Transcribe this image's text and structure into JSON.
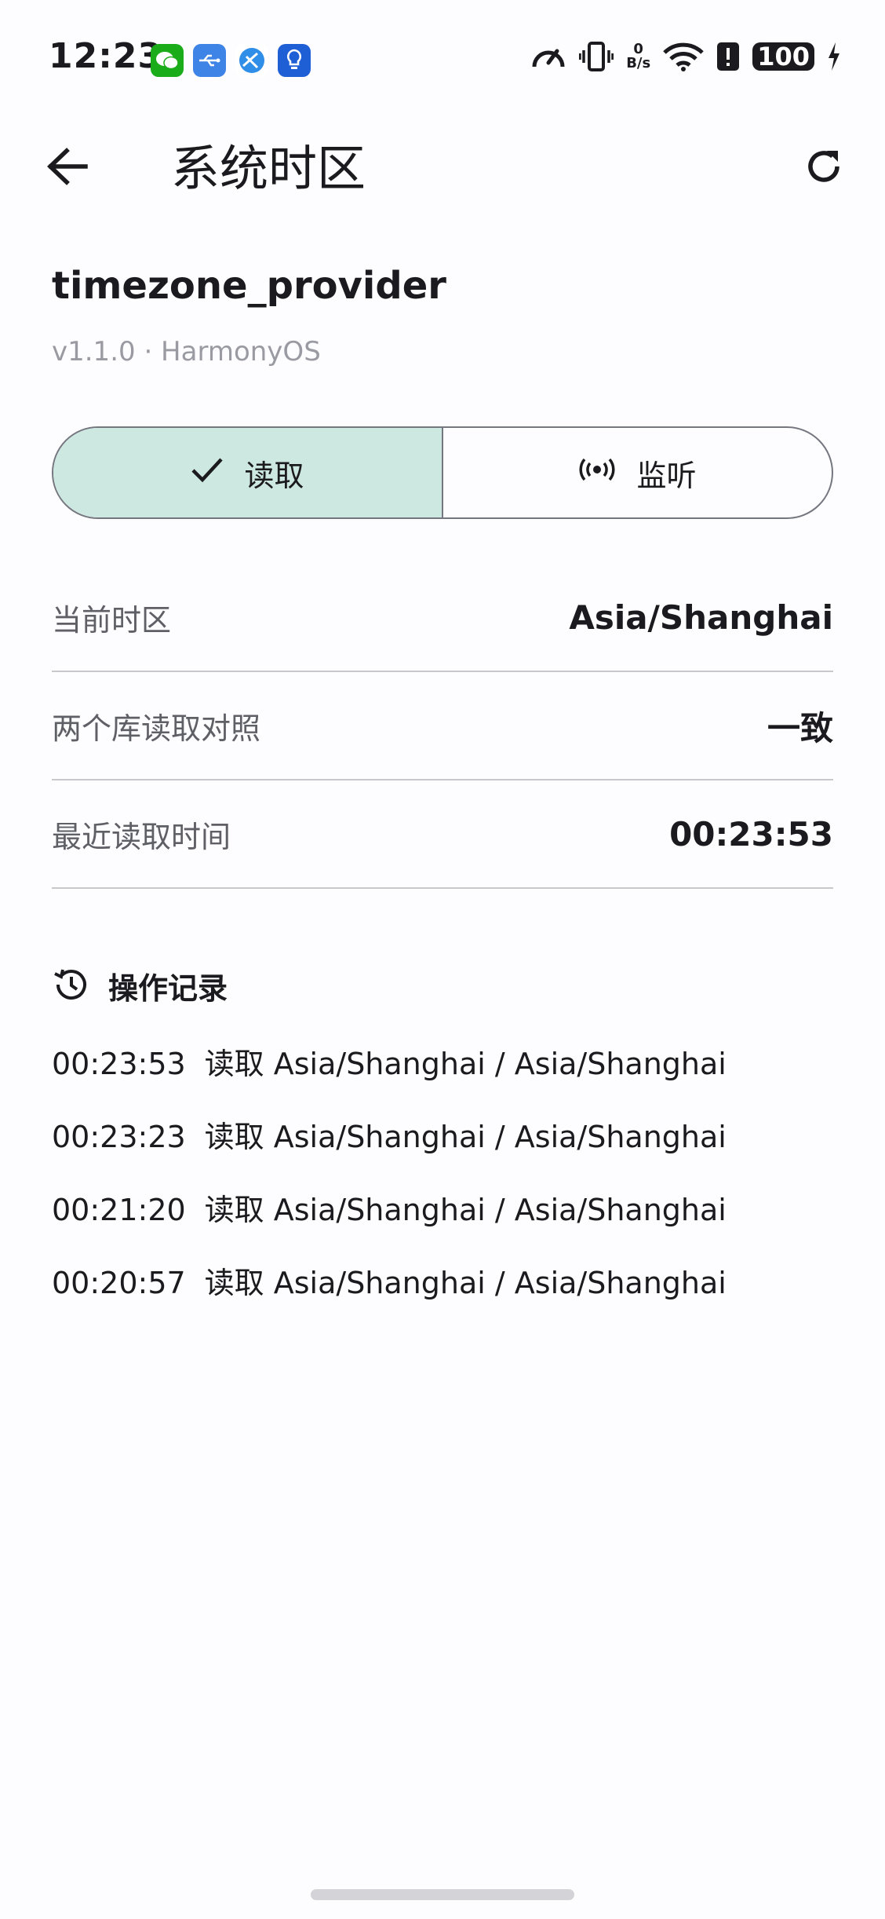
{
  "status_bar": {
    "time": "12:23",
    "net_speed_value": "0",
    "net_speed_unit": "B/s",
    "battery": "100"
  },
  "app_bar": {
    "title": "系统时区"
  },
  "provider": {
    "name": "timezone_provider",
    "meta": "v1.1.0 · HarmonyOS"
  },
  "tabs": [
    {
      "label": "读取",
      "selected": true
    },
    {
      "label": "监听",
      "selected": false
    }
  ],
  "info": [
    {
      "label": "当前时区",
      "value": "Asia/Shanghai"
    },
    {
      "label": "两个库读取对照",
      "value": "一致"
    },
    {
      "label": "最近读取时间",
      "value": "00:23:53"
    }
  ],
  "log": {
    "title": "操作记录",
    "entries": [
      {
        "time": "00:23:53",
        "text": "读取 Asia/Shanghai / Asia/Shanghai"
      },
      {
        "time": "00:23:23",
        "text": "读取 Asia/Shanghai / Asia/Shanghai"
      },
      {
        "time": "00:21:20",
        "text": "读取 Asia/Shanghai / Asia/Shanghai"
      },
      {
        "time": "00:20:57",
        "text": "读取 Asia/Shanghai / Asia/Shanghai"
      }
    ]
  },
  "colors": {
    "accent_selected": "#cde8e0",
    "background": "#fdfcff",
    "divider": "#c8c7cc"
  }
}
